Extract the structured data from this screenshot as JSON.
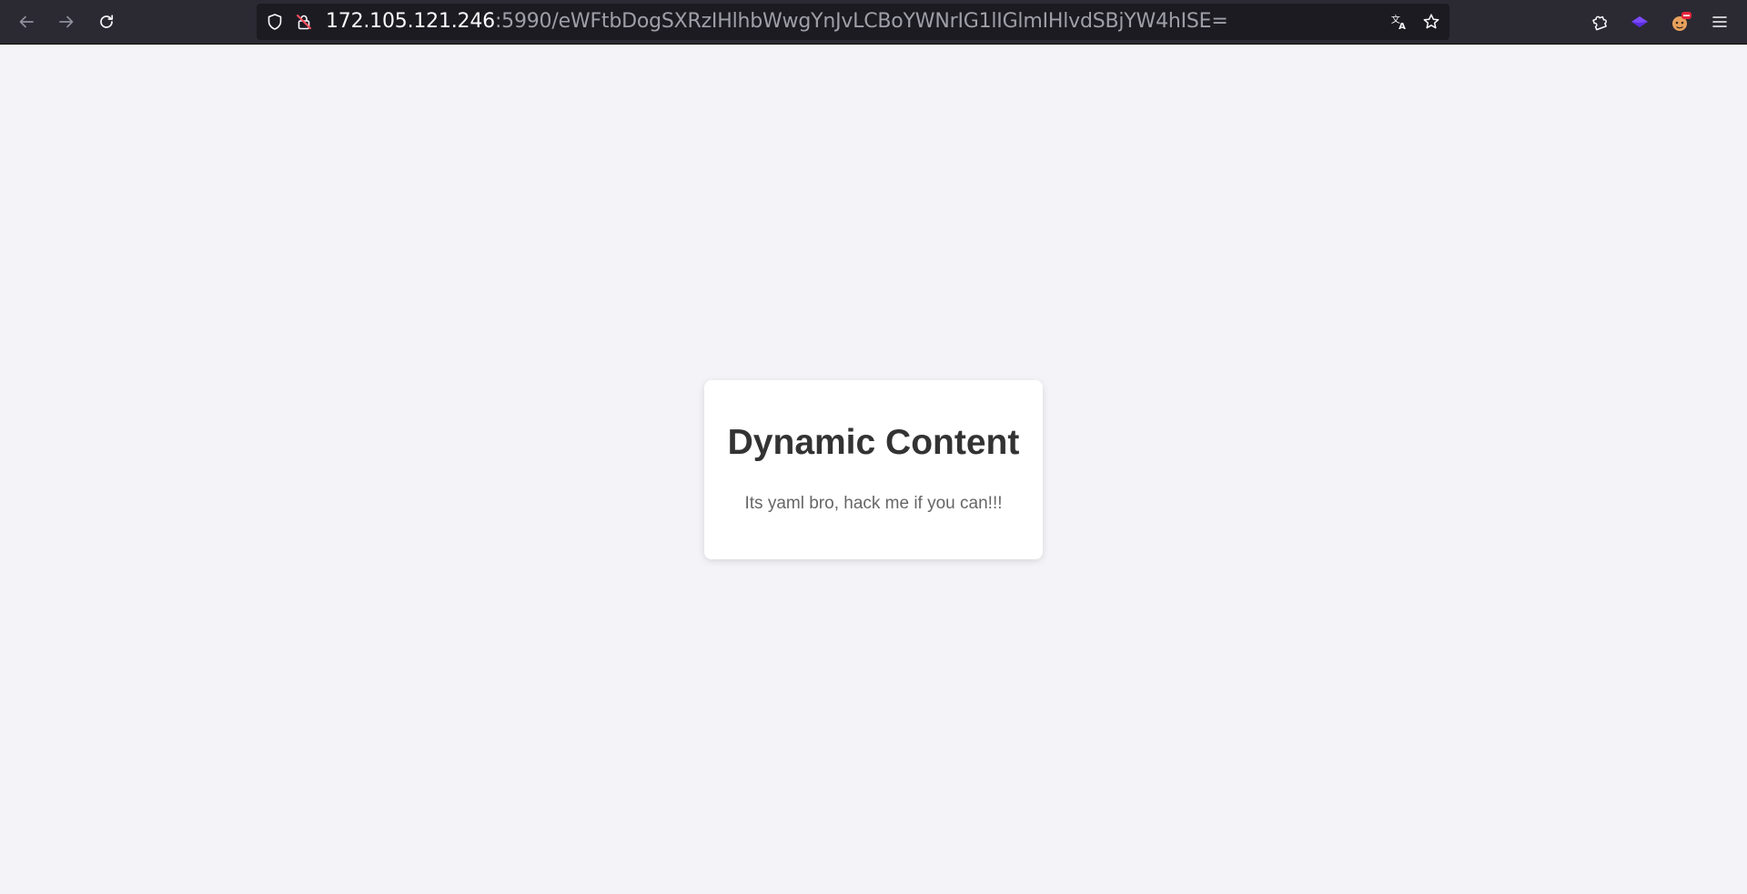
{
  "browser": {
    "url_host": "172.105.121.246",
    "url_rest": ":5990/eWFtbDogSXRzIHlhbWwgYnJvLCBoYWNrIG1lIGlmIHlvdSBjYW4hISE=",
    "icons": {
      "back": "arrow-left-icon",
      "forward": "arrow-right-icon",
      "reload": "reload-icon",
      "tracking_protection": "shield-icon",
      "connection": "insecure-lock-icon",
      "translate": "translate-icon",
      "bookmark": "star-icon",
      "extensions": "puzzle-icon",
      "extension_1": "purple-extension-icon",
      "extension_2": "avatar-extension-icon",
      "menu": "hamburger-menu-icon"
    },
    "colors": {
      "toolbar": "#2b2a33",
      "urlbar": "#1c1b22",
      "url_host": "#fbfbfe",
      "url_rest": "#9f9fa8"
    }
  },
  "page": {
    "background": "#f4f4f8",
    "card": {
      "title": "Dynamic Content",
      "text": "Its yaml bro, hack me if you can!!!"
    }
  }
}
